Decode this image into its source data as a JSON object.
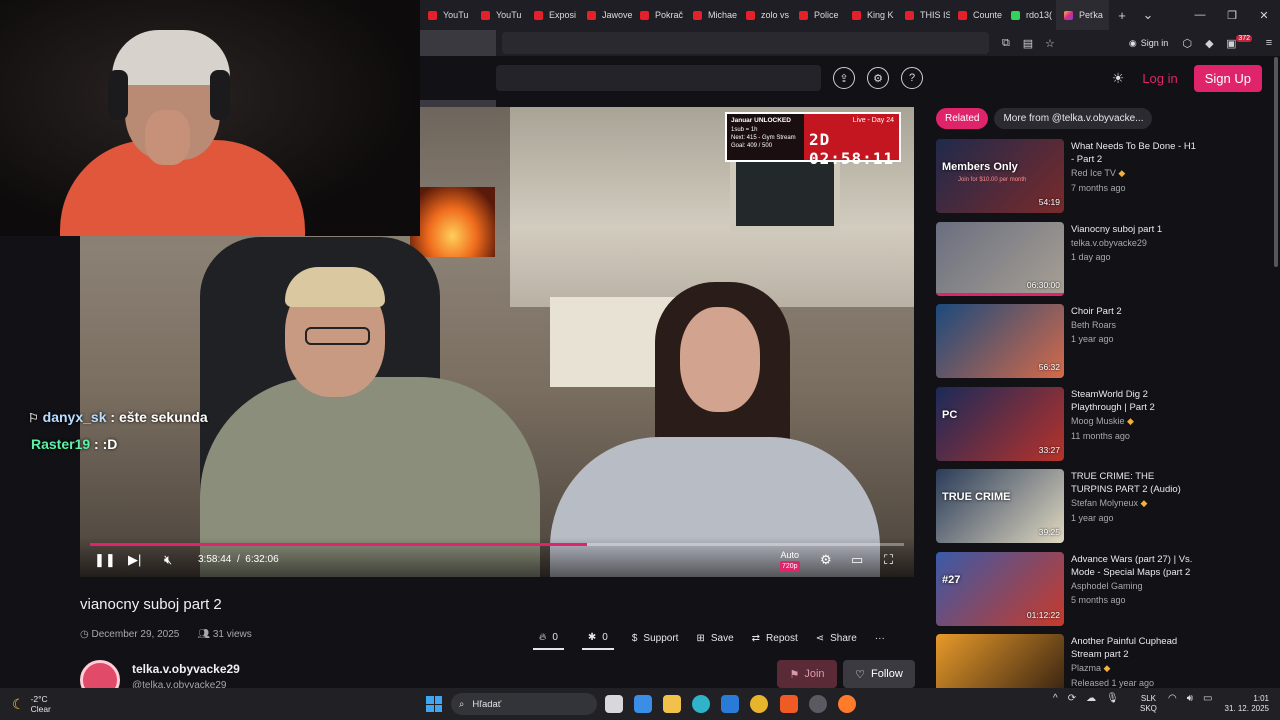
{
  "browser": {
    "tabs": [
      {
        "label": "YouTu",
        "fav": "yt"
      },
      {
        "label": "YouTu",
        "fav": "yt"
      },
      {
        "label": "Exposi",
        "fav": "yt"
      },
      {
        "label": "Jawove",
        "fav": "yt"
      },
      {
        "label": "Pokrač",
        "fav": "yt"
      },
      {
        "label": "Michae",
        "fav": "yt"
      },
      {
        "label": "zolo vs",
        "fav": "yt"
      },
      {
        "label": "Police",
        "fav": "yt"
      },
      {
        "label": "King K",
        "fav": "yt"
      },
      {
        "label": "THIS IS",
        "fav": "yt"
      },
      {
        "label": "Counte",
        "fav": "yt"
      },
      {
        "label": "rdo13(",
        "fav": "kick"
      },
      {
        "label": "Peťka",
        "fav": "ig",
        "active": true
      }
    ],
    "new_tab_icon": "plus-icon",
    "sign_in_label": "Sign in",
    "extensions_badge": "372"
  },
  "site": {
    "login_label": "Log in",
    "signup_label": "Sign Up"
  },
  "video": {
    "overlay": {
      "line1": "Januar UNLOCKED",
      "line2": "1sub = 1h",
      "line3": "Next: 415 - Gym Stream",
      "line4": "Goal: 409 / 500",
      "live": "Live - Day 24",
      "timer": "2D 02:58:11"
    },
    "chat": [
      {
        "user": "danyx_sk",
        "sep": " : ",
        "message": "ešte sekunda"
      },
      {
        "user": "Raster19",
        "sep": " : ",
        "message": ":D"
      }
    ],
    "current_time": "3:58:44",
    "time_sep": "/",
    "duration": "6:32:06",
    "progress": 0.61,
    "quality_label": "Auto",
    "quality_value": "720p",
    "title": "vianocny suboj part 2",
    "date": "December 29, 2025",
    "views": "31 views",
    "likes": "0",
    "dislikes": "0",
    "support_label": "Support",
    "save_label": "Save",
    "repost_label": "Repost",
    "share_label": "Share",
    "more_label": "···"
  },
  "channel": {
    "name": "telka.v.obyvacke29",
    "handle": "@telka.v.obyvacke29",
    "join_label": "Join",
    "follow_label": "Follow"
  },
  "sidebar": {
    "tabs": [
      {
        "label": "Related",
        "active": true
      },
      {
        "label": "More from @telka.v.obyvacke..."
      }
    ],
    "items": [
      {
        "title": "What Needs To Be Done - H1 - Part 2",
        "author": "Red Ice TV",
        "verified": true,
        "age": "7 months ago",
        "duration": "54:19",
        "thumb_text": "Members Only",
        "thumb_sub": "Join for $10.00 per month",
        "colors": [
          "#1f2a4c",
          "#7a2a2a"
        ],
        "progress": 0
      },
      {
        "title": "Vianocny suboj part 1",
        "author": "telka.v.obyvacke29",
        "verified": false,
        "age": "1 day ago",
        "duration": "06:30:00",
        "colors": [
          "#6a6e80",
          "#a8a094"
        ],
        "progress": 1.0
      },
      {
        "title": "Choir Part 2",
        "author": "Beth Roars",
        "verified": false,
        "age": "1 year ago",
        "duration": "56:32",
        "colors": [
          "#1b4a7c",
          "#d56a4a"
        ],
        "progress": 0
      },
      {
        "title": "SteamWorld Dig 2 Playthrough | Part 2",
        "author": "Moog Muskie",
        "verified": true,
        "age": "11 months ago",
        "duration": "33:27",
        "thumb_text": "PC",
        "colors": [
          "#1a2a5a",
          "#b8322a"
        ],
        "progress": 0
      },
      {
        "title": "TRUE CRIME: THE TURPINS PART 2 (Audio)",
        "author": "Stefan Molyneux",
        "verified": true,
        "age": "1 year ago",
        "duration": "39:25",
        "thumb_text": "TRUE CRIME",
        "colors": [
          "#2a3c5a",
          "#e0d8c0"
        ],
        "progress": 0
      },
      {
        "title": "Advance Wars (part 27) | Vs. Mode - Special Maps (part 2",
        "author": "Asphodel Gaming",
        "verified": false,
        "age": "5 months ago",
        "duration": "01:12:22",
        "thumb_text": "#27",
        "colors": [
          "#3a5aa8",
          "#c83a2a"
        ],
        "progress": 0
      },
      {
        "title": "Another Painful Cuphead Stream part 2",
        "author": "Plazma",
        "verified": true,
        "age": "Released 1 year ago",
        "duration": "",
        "colors": [
          "#e89a2a",
          "#2a1a10"
        ],
        "progress": 0
      }
    ]
  },
  "taskbar": {
    "temp": "-2°C",
    "weather": "Clear",
    "search_placeholder": "Hľadať",
    "lang1": "SLK",
    "lang2": "SKQ",
    "time": "1:01",
    "date": "31. 12. 2025"
  }
}
